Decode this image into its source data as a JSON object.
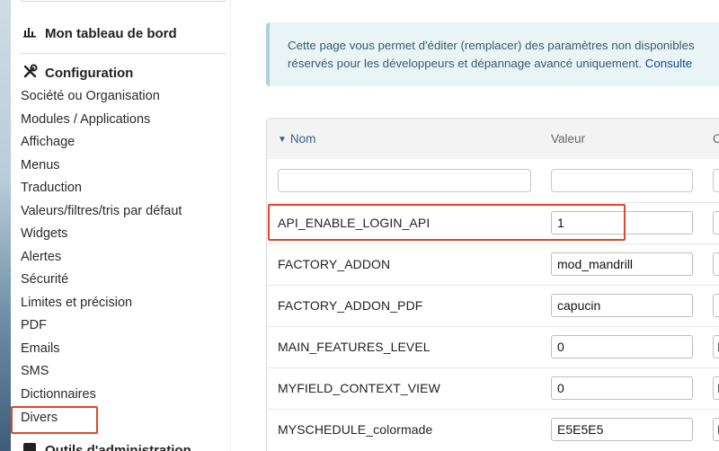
{
  "sidebar": {
    "dashboard": {
      "label": "Mon tableau de bord",
      "icon": "bar-chart-icon"
    },
    "configuration": {
      "label": "Configuration",
      "icon": "tools-icon"
    },
    "items": [
      "Société ou Organisation",
      "Modules / Applications",
      "Affichage",
      "Menus",
      "Traduction",
      "Valeurs/filtres/tris par défaut",
      "Widgets",
      "Alertes",
      "Sécurité",
      "Limites et précision",
      "PDF",
      "Emails",
      "SMS",
      "Dictionnaires",
      "Divers"
    ],
    "next_section": {
      "label": "Outils d'administration",
      "icon": "admin-tools-icon"
    },
    "highlighted_item": "Divers"
  },
  "info": {
    "line1": "Cette page vous permet d'éditer (remplacer) des paramètres non disponibles",
    "line2": "réservés pour les développeurs et dépannage avancé uniquement.",
    "link": "Consulte"
  },
  "table": {
    "headers": {
      "name": "Nom",
      "value": "Valeur",
      "third": "C"
    },
    "rows": [
      {
        "name": "API_ENABLE_LOGIN_API",
        "value": "1",
        "third": ""
      },
      {
        "name": "FACTORY_ADDON",
        "value": "mod_mandrill",
        "third": ""
      },
      {
        "name": "FACTORY_ADDON_PDF",
        "value": "capucin",
        "third": ""
      },
      {
        "name": "MAIN_FEATURES_LEVEL",
        "value": "0",
        "third": "I"
      },
      {
        "name": "MYFIELD_CONTEXT_VIEW",
        "value": "0",
        "third": "I"
      },
      {
        "name": "MYSCHEDULE_colormade",
        "value": "E5E5E5",
        "third": "I"
      }
    ],
    "highlighted_row": "API_ENABLE_LOGIN_API"
  },
  "colors": {
    "highlight": "#e0472a",
    "info_bg": "#e9f4f7",
    "link": "#0d4a9f"
  }
}
